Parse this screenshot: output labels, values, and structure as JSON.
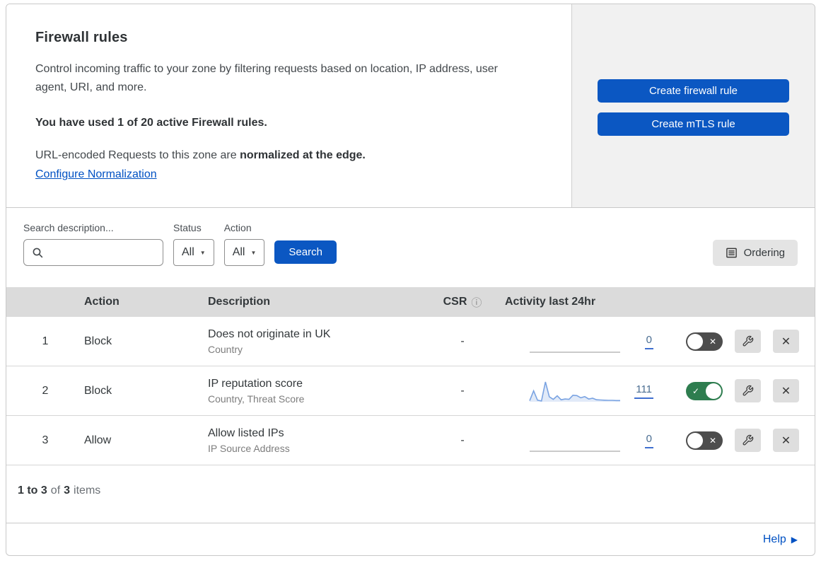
{
  "colors": {
    "primary_blue": "#0b57c2",
    "link_blue": "#0051c3",
    "toggle_on_green": "#2e7d4f",
    "toggle_off_gray": "#4d4d4d",
    "sparkline_blue": "#7aa3e2",
    "sparkline_fill": "#e1eaf8",
    "sparkline_flat_gray": "#b9b9b9",
    "table_header_gray": "#dbdbdb"
  },
  "header": {
    "title": "Firewall rules",
    "description": "Control incoming traffic to your zone by filtering requests based on location, IP address, user agent, URI, and more.",
    "usage_note": "You have used 1 of 20 active Firewall rules.",
    "normalization_text": "URL-encoded Requests to this zone are ",
    "normalization_bold": "normalized at the edge.",
    "configure_link": "Configure Normalization",
    "create_firewall_button": "Create firewall rule",
    "create_mtls_button": "Create mTLS rule"
  },
  "filters": {
    "search_label": "Search description...",
    "search_value": "",
    "status_label": "Status",
    "status_value": "All",
    "action_label": "Action",
    "action_value": "All",
    "search_button": "Search",
    "ordering_button": "Ordering"
  },
  "table": {
    "columns": {
      "action": "Action",
      "description": "Description",
      "csr": "CSR",
      "activity": "Activity last 24hr"
    },
    "rows": [
      {
        "priority": "1",
        "action": "Block",
        "description": "Does not originate in UK",
        "match": "Country",
        "csr": "-",
        "activity": {
          "count": "0",
          "sparkline": [
            0,
            0,
            0,
            0,
            0,
            0,
            0,
            0,
            0,
            0
          ]
        },
        "enabled": false
      },
      {
        "priority": "2",
        "action": "Block",
        "description": "IP reputation score",
        "match": "Country, Threat Score",
        "csr": "-",
        "activity": {
          "count": "111",
          "sparkline": [
            5,
            55,
            8,
            4,
            100,
            25,
            12,
            30,
            10,
            14,
            12,
            33,
            31,
            20,
            26,
            14,
            18,
            10,
            9,
            8,
            7,
            7,
            6,
            6
          ]
        },
        "enabled": true
      },
      {
        "priority": "3",
        "action": "Allow",
        "description": "Allow listed IPs",
        "match": "IP Source Address",
        "csr": "-",
        "activity": {
          "count": "0",
          "sparkline": [
            0,
            0,
            0,
            0,
            0,
            0,
            0,
            0,
            0,
            0
          ]
        },
        "enabled": false
      }
    ]
  },
  "footer": {
    "range_bold": "1 to 3",
    "of_text": "of",
    "total_bold": "3",
    "items_text": "items",
    "help_link": "Help"
  },
  "icons": {
    "search": "magnifier",
    "dropdown_caret": "▼",
    "info": "ⓘ",
    "ordering": "list-lines",
    "toggle_check": "✓",
    "toggle_cross": "✕",
    "wrench": "wrench",
    "delete": "✕",
    "help_arrow": "▶"
  }
}
